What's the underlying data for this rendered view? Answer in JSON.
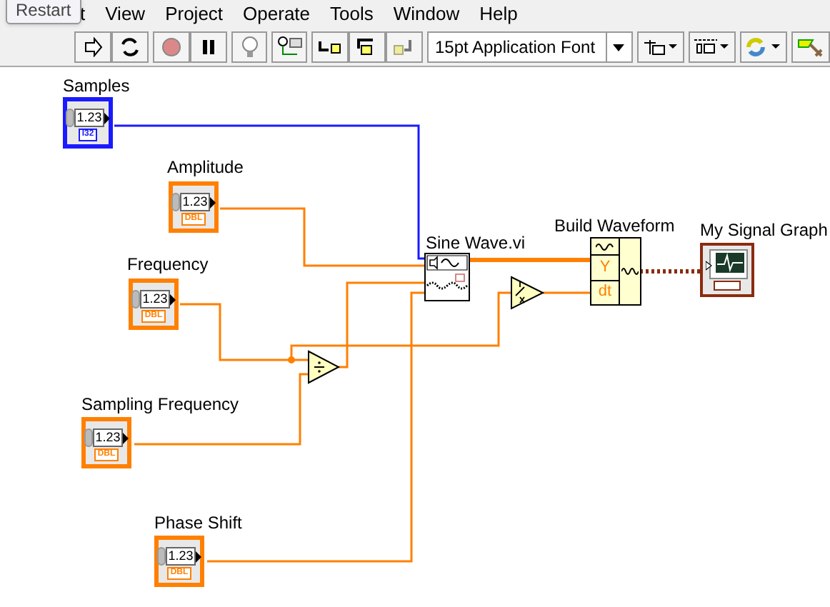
{
  "tooltip": "Restart",
  "menu": [
    "t",
    "View",
    "Project",
    "Operate",
    "Tools",
    "Window",
    "Help"
  ],
  "toolbar": {
    "font": "15pt Application Font",
    "running": false
  },
  "terminals": [
    {
      "label": "Samples",
      "value": "1.23",
      "repr": "I32",
      "kind": "i32"
    },
    {
      "label": "Amplitude",
      "value": "1.23",
      "repr": "DBL",
      "kind": "dbl"
    },
    {
      "label": "Frequency",
      "value": "1.23",
      "repr": "DBL",
      "kind": "dbl"
    },
    {
      "label": "Sampling Frequency",
      "value": "1.23",
      "repr": "DBL",
      "kind": "dbl"
    },
    {
      "label": "Phase Shift",
      "value": "1.23",
      "repr": "DBL",
      "kind": "dbl"
    }
  ],
  "sine_wave": {
    "label": "Sine Wave.vi"
  },
  "build_waveform": {
    "label": "Build Waveform",
    "ports": [
      "Y",
      "dt"
    ]
  },
  "graph": {
    "label": "My Signal Graph"
  }
}
